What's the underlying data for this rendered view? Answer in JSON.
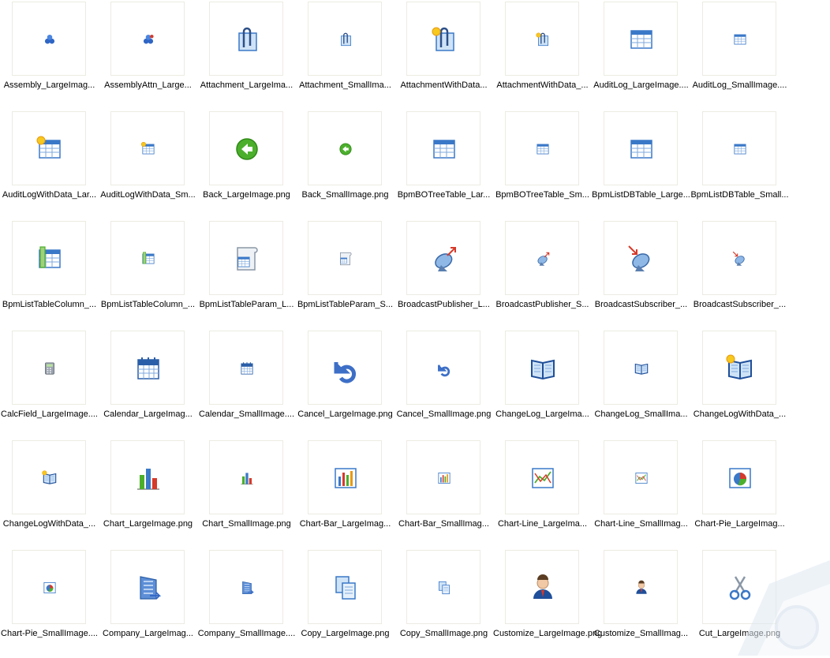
{
  "files": [
    {
      "label": "Assembly_LargeImag...",
      "icon": "assembly-icon",
      "size": "small"
    },
    {
      "label": "AssemblyAttn_Large...",
      "icon": "assembly-attention-icon",
      "size": "small"
    },
    {
      "label": "Attachment_LargeIma...",
      "icon": "attachment-icon",
      "size": "large"
    },
    {
      "label": "Attachment_SmallIma...",
      "icon": "attachment-icon",
      "size": "small"
    },
    {
      "label": "AttachmentWithData...",
      "icon": "attachment-with-data-icon",
      "size": "large"
    },
    {
      "label": "AttachmentWithData_...",
      "icon": "attachment-with-data-icon",
      "size": "small"
    },
    {
      "label": "AuditLog_LargeImage....",
      "icon": "table-icon",
      "size": "large"
    },
    {
      "label": "AuditLog_SmallImage....",
      "icon": "table-icon",
      "size": "small"
    },
    {
      "label": "AuditLogWithData_Lar...",
      "icon": "table-with-data-icon",
      "size": "large"
    },
    {
      "label": "AuditLogWithData_Sm...",
      "icon": "table-with-data-icon",
      "size": "small"
    },
    {
      "label": "Back_LargeImage.png",
      "icon": "back-arrow-icon",
      "size": "large"
    },
    {
      "label": "Back_SmallImage.png",
      "icon": "back-arrow-icon",
      "size": "small"
    },
    {
      "label": "BpmBOTreeTable_Lar...",
      "icon": "table-icon",
      "size": "large"
    },
    {
      "label": "BpmBOTreeTable_Sm...",
      "icon": "table-icon",
      "size": "small"
    },
    {
      "label": "BpmListDBTable_Large...",
      "icon": "table-icon",
      "size": "large"
    },
    {
      "label": "BpmListDBTable_Small...",
      "icon": "table-icon",
      "size": "small"
    },
    {
      "label": "BpmListTableColumn_...",
      "icon": "table-column-icon",
      "size": "large"
    },
    {
      "label": "BpmListTableColumn_...",
      "icon": "table-column-icon",
      "size": "small"
    },
    {
      "label": "BpmListTableParam_L...",
      "icon": "table-param-icon",
      "size": "large"
    },
    {
      "label": "BpmListTableParam_S...",
      "icon": "table-param-icon",
      "size": "small"
    },
    {
      "label": "BroadcastPublisher_L...",
      "icon": "satellite-publisher-icon",
      "size": "large"
    },
    {
      "label": "BroadcastPublisher_S...",
      "icon": "satellite-publisher-icon",
      "size": "small"
    },
    {
      "label": "BroadcastSubscriber_...",
      "icon": "satellite-subscriber-icon",
      "size": "large"
    },
    {
      "label": "BroadcastSubscriber_...",
      "icon": "satellite-subscriber-icon",
      "size": "small"
    },
    {
      "label": "CalcField_LargeImage....",
      "icon": "calculator-icon",
      "size": "small"
    },
    {
      "label": "Calendar_LargeImag...",
      "icon": "calendar-icon",
      "size": "large"
    },
    {
      "label": "Calendar_SmallImage....",
      "icon": "calendar-icon",
      "size": "small"
    },
    {
      "label": "Cancel_LargeImage.png",
      "icon": "undo-arrow-icon",
      "size": "large"
    },
    {
      "label": "Cancel_SmallImage.png",
      "icon": "undo-arrow-icon",
      "size": "small"
    },
    {
      "label": "ChangeLog_LargeIma...",
      "icon": "book-icon",
      "size": "large"
    },
    {
      "label": "ChangeLog_SmallIma...",
      "icon": "book-icon",
      "size": "small"
    },
    {
      "label": "ChangeLogWithData_...",
      "icon": "book-with-data-icon",
      "size": "large"
    },
    {
      "label": "ChangeLogWithData_...",
      "icon": "book-with-data-icon",
      "size": "small"
    },
    {
      "label": "Chart_LargeImage.png",
      "icon": "chart-icon",
      "size": "large"
    },
    {
      "label": "Chart_SmallImage.png",
      "icon": "chart-icon",
      "size": "small"
    },
    {
      "label": "Chart-Bar_LargeImag...",
      "icon": "bar-chart-icon",
      "size": "large"
    },
    {
      "label": "Chart-Bar_SmallImag...",
      "icon": "bar-chart-icon",
      "size": "small"
    },
    {
      "label": "Chart-Line_LargeIma...",
      "icon": "line-chart-icon",
      "size": "large"
    },
    {
      "label": "Chart-Line_SmallImag...",
      "icon": "line-chart-icon",
      "size": "small"
    },
    {
      "label": "Chart-Pie_LargeImag...",
      "icon": "pie-chart-icon",
      "size": "large"
    },
    {
      "label": "Chart-Pie_SmallImage....",
      "icon": "pie-chart-icon",
      "size": "small"
    },
    {
      "label": "Company_LargeImag...",
      "icon": "company-icon",
      "size": "large"
    },
    {
      "label": "Company_SmallImage....",
      "icon": "company-icon",
      "size": "small"
    },
    {
      "label": "Copy_LargeImage.png",
      "icon": "copy-icon",
      "size": "large"
    },
    {
      "label": "Copy_SmallImage.png",
      "icon": "copy-icon",
      "size": "small"
    },
    {
      "label": "Customize_LargeImage.png",
      "icon": "user-icon",
      "size": "large",
      "wrap": true
    },
    {
      "label": "Customize_SmallImag...",
      "icon": "user-icon",
      "size": "small"
    },
    {
      "label": "Cut_LargeImage.png",
      "icon": "scissors-icon",
      "size": "large"
    }
  ],
  "colors": {
    "thumb_border": "#ecebe2",
    "blue": "#3a78c8",
    "light_blue": "#cfe3f7",
    "green": "#4caf2c",
    "sun": "#f7c81e",
    "red": "#d63a2a"
  }
}
